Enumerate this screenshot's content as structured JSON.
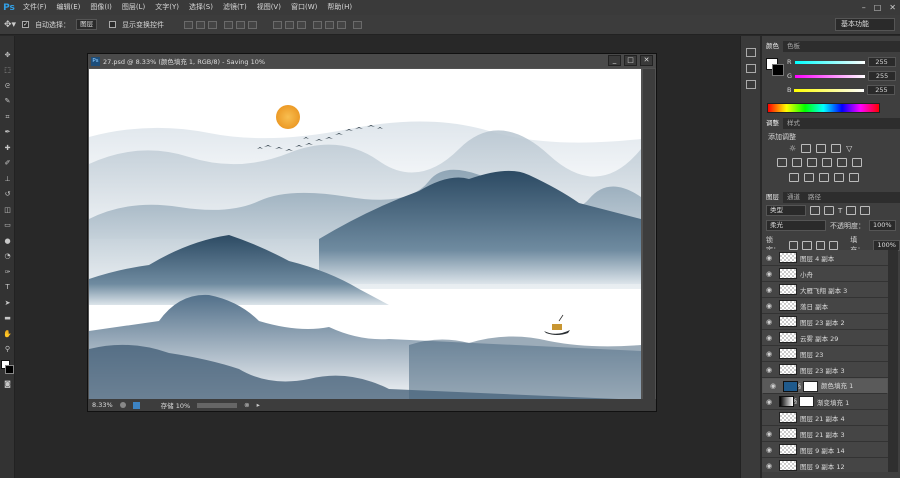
{
  "menu": {
    "logo": "Ps",
    "items": [
      "文件(F)",
      "编辑(E)",
      "图像(I)",
      "图层(L)",
      "文字(Y)",
      "选择(S)",
      "滤镜(T)",
      "视图(V)",
      "窗口(W)",
      "帮助(H)"
    ],
    "window_controls": [
      "–",
      "□",
      "✕"
    ]
  },
  "options": {
    "auto_select_label": "自动选择：",
    "auto_select_value": "图层",
    "transform_label": "显示变换控件",
    "workspace": "基本功能"
  },
  "document": {
    "title": "27.psd @ 8.33% (颜色填充 1, RGB/8) - Saving 10%",
    "zoom": "8.33%",
    "save_status": "存储 10%",
    "buttons": [
      "_",
      "□",
      "✕"
    ]
  },
  "color_panel": {
    "tabs": [
      "颜色",
      "色板"
    ],
    "channels": [
      {
        "name": "R",
        "value": "255"
      },
      {
        "name": "G",
        "value": "255"
      },
      {
        "name": "B",
        "value": "255"
      }
    ]
  },
  "adjust_panel": {
    "tabs": [
      "调整",
      "样式"
    ],
    "heading": "添加调整"
  },
  "layers_panel": {
    "tabs": [
      "图层",
      "通道",
      "路径"
    ],
    "filter": "类型",
    "blend_mode": "柔光",
    "opacity_label": "不透明度：",
    "opacity": "100%",
    "lock_label": "锁定：",
    "fill_label": "填充：",
    "fill": "100%",
    "layers": [
      {
        "name": "图层 4 副本",
        "visible": true,
        "kind": "pixel"
      },
      {
        "name": "小舟",
        "visible": true,
        "kind": "pixel"
      },
      {
        "name": "大雁飞翔 副本 3",
        "visible": true,
        "kind": "pixel"
      },
      {
        "name": "落日 副本",
        "visible": true,
        "kind": "pixel"
      },
      {
        "name": "图层 23 副本 2",
        "visible": true,
        "kind": "pixel"
      },
      {
        "name": "云雾 副本 29",
        "visible": true,
        "kind": "pixel"
      },
      {
        "name": "图层 23",
        "visible": true,
        "kind": "pixel"
      },
      {
        "name": "图层 23 副本 3",
        "visible": true,
        "kind": "pixel"
      },
      {
        "name": "颜色填充 1",
        "visible": true,
        "kind": "fill",
        "selected": true
      },
      {
        "name": "渐变填充 1",
        "visible": true,
        "kind": "gradient"
      },
      {
        "name": "图层 21 副本 4",
        "visible": false,
        "kind": "pixel"
      },
      {
        "name": "图层 21 副本 3",
        "visible": true,
        "kind": "pixel"
      },
      {
        "name": "图层 9 副本 14",
        "visible": true,
        "kind": "pixel"
      },
      {
        "name": "图层 9 副本 12",
        "visible": true,
        "kind": "pixel"
      }
    ]
  },
  "colors": {
    "accent_fill": "#1f5a8c",
    "sun": "#f0a830",
    "mountain_dark": "#2d4a62",
    "mountain_mid": "#5f7d93"
  },
  "icons": [
    "move-tool-icon",
    "marquee-tool-icon",
    "lasso-tool-icon",
    "quick-select-icon",
    "crop-tool-icon",
    "eyedropper-icon",
    "heal-brush-icon",
    "brush-tool-icon",
    "stamp-tool-icon",
    "history-brush-icon",
    "eraser-icon",
    "gradient-tool-icon",
    "blur-tool-icon",
    "dodge-tool-icon",
    "pen-tool-icon",
    "type-tool-icon",
    "path-select-icon",
    "shape-tool-icon",
    "hand-tool-icon",
    "zoom-tool-icon",
    "eye-icon",
    "link-icon"
  ]
}
